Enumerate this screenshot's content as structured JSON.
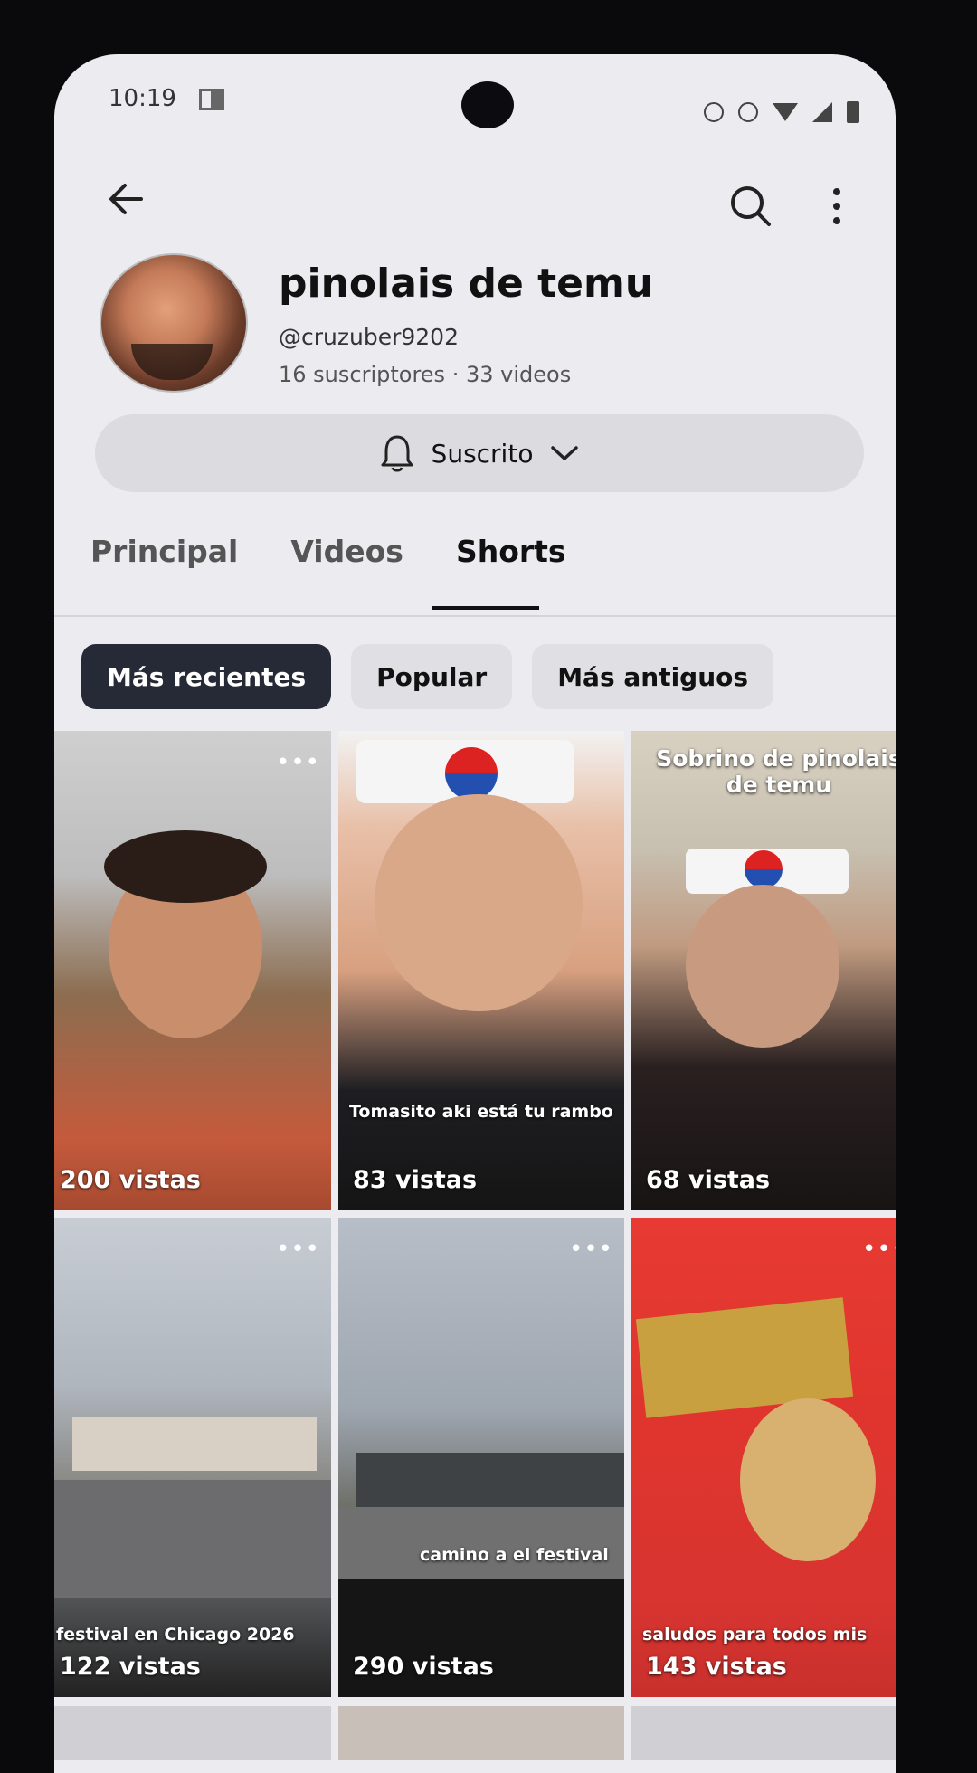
{
  "status_bar": {
    "time": "10:19"
  },
  "channel": {
    "name": "pinolais de temu",
    "handle": "@cruzuber9202",
    "subscribers": "16 suscriptores",
    "separator": "·",
    "videos": "33 videos"
  },
  "subscribe_button": {
    "label": "Suscrito"
  },
  "tabs": [
    {
      "label": "Principal",
      "active": false
    },
    {
      "label": "Videos",
      "active": false
    },
    {
      "label": "Shorts",
      "active": true
    }
  ],
  "filters": [
    {
      "label": "Más recientes",
      "active": true
    },
    {
      "label": "Popular",
      "active": false
    },
    {
      "label": "Más antiguos",
      "active": false
    }
  ],
  "shorts": [
    {
      "views": "200 vistas",
      "overlay_text": "",
      "title_top": ""
    },
    {
      "views": "83 vistas",
      "overlay_text": "Tomasito aki está tu rambo",
      "title_top": ""
    },
    {
      "views": "68 vistas",
      "overlay_text": "",
      "title_top": "Sobrino de pinolais de temu"
    },
    {
      "views": "122 vistas",
      "overlay_text": "festival  en Chicago 2026",
      "title_top": ""
    },
    {
      "views": "290 vistas",
      "overlay_text": "camino a el festival",
      "title_top": ""
    },
    {
      "views": "143 vistas",
      "overlay_text": "saludos para todos mis",
      "title_top": ""
    }
  ],
  "icons": {
    "back": "arrow-left-icon",
    "search": "search-icon",
    "more": "more-vert-icon",
    "bell": "bell-icon",
    "chevron": "chevron-down-icon",
    "tile_menu": "more-horiz-icon"
  },
  "colors": {
    "active_chip": "#262a36",
    "background": "#ececf0"
  }
}
